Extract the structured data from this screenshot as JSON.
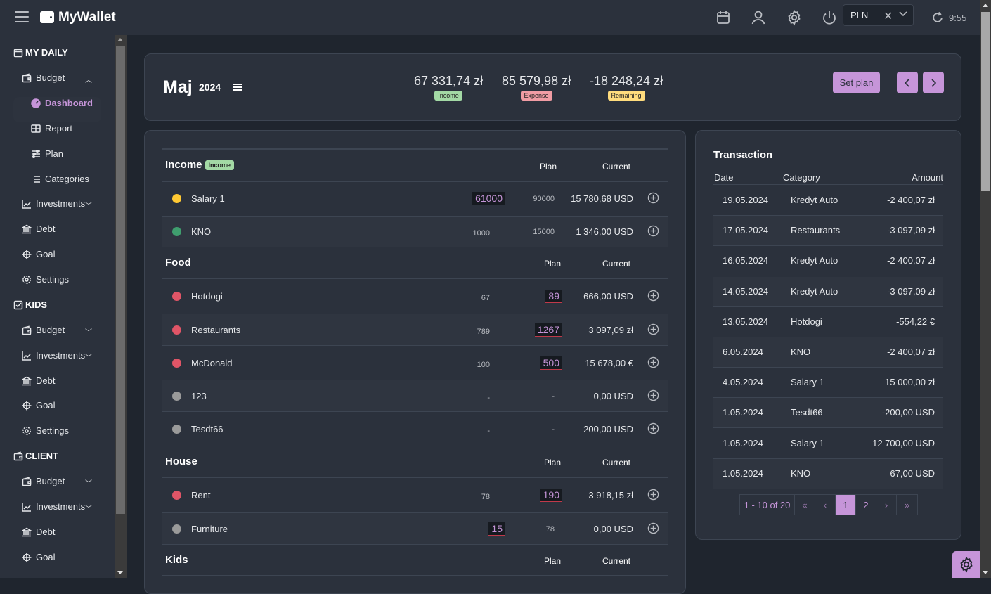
{
  "app": {
    "title": "MyWallet",
    "clock": "9:55"
  },
  "topbar": {
    "currency": "PLN",
    "icons": [
      "calendar-icon",
      "user-icon",
      "gear-icon",
      "power-icon",
      "refresh-icon"
    ]
  },
  "sidebar": {
    "sections": [
      {
        "label": "MY DAILY",
        "items": [
          {
            "label": "Budget",
            "expanded": true,
            "children": [
              "Dashboard",
              "Report",
              "Plan",
              "Categories"
            ]
          },
          {
            "label": "Investments"
          },
          {
            "label": "Debt"
          },
          {
            "label": "Goal"
          },
          {
            "label": "Settings"
          }
        ]
      },
      {
        "label": "KIDS",
        "items": [
          {
            "label": "Budget"
          },
          {
            "label": "Investments"
          },
          {
            "label": "Debt"
          },
          {
            "label": "Goal"
          },
          {
            "label": "Settings"
          }
        ]
      },
      {
        "label": "CLIENT",
        "items": [
          {
            "label": "Budget"
          },
          {
            "label": "Investments"
          },
          {
            "label": "Debt"
          },
          {
            "label": "Goal"
          }
        ]
      }
    ],
    "active": "Dashboard"
  },
  "summary": {
    "month": "Maj",
    "year": "2024",
    "income": {
      "value": "67 331,74 zł",
      "label": "Income",
      "color": "#a3d9a5"
    },
    "expense": {
      "value": "85 579,98 zł",
      "label": "Expense",
      "color": "#f19ca4"
    },
    "remaining": {
      "value": "-18 248,24 zł",
      "label": "Remaining",
      "color": "#ffdc7d"
    },
    "set_plan_label": "Set plan"
  },
  "budget": {
    "plan_header": "Plan",
    "current_header": "Current",
    "income_badge": "Income",
    "sections": [
      {
        "title": "Income",
        "rows": [
          {
            "name": "Salary 1",
            "color": "#ffc933",
            "col1": "61000",
            "col1_input": true,
            "col2": "90000",
            "col2_input": false,
            "current": "15 780,68 USD"
          },
          {
            "name": "KNO",
            "color": "#3f9e6e",
            "col1": "1000",
            "col1_input": false,
            "col2": "15000",
            "col2_input": false,
            "current": "1 346,00 USD"
          }
        ]
      },
      {
        "title": "Food",
        "rows": [
          {
            "name": "Hotdogi",
            "color": "#e05567",
            "col1": "67",
            "col1_input": false,
            "col2": "89",
            "col2_input": true,
            "current": "666,00 USD"
          },
          {
            "name": "Restaurants",
            "color": "#e05567",
            "col1": "789",
            "col1_input": false,
            "col2": "1267",
            "col2_input": true,
            "current": "3 097,09 zł"
          },
          {
            "name": "McDonald",
            "color": "#e05567",
            "col1": "100",
            "col1_input": false,
            "col2": "500",
            "col2_input": true,
            "current": "15 678,00 €"
          },
          {
            "name": "123",
            "color": "#9a9a9a",
            "col1": "-",
            "col1_input": false,
            "col2": "-",
            "col2_input": false,
            "current": "0,00 USD"
          },
          {
            "name": "Tesdt66",
            "color": "#9a9a9a",
            "col1": "-",
            "col1_input": false,
            "col2": "-",
            "col2_input": false,
            "current": "200,00 USD"
          }
        ]
      },
      {
        "title": "House",
        "rows": [
          {
            "name": "Rent",
            "color": "#e05567",
            "col1": "78",
            "col1_input": false,
            "col2": "190",
            "col2_input": true,
            "current": "3 918,15 zł"
          },
          {
            "name": "Furniture",
            "color": "#9a9a9a",
            "col1": "15",
            "col1_input": true,
            "col2": "78",
            "col2_input": false,
            "current": "0,00 USD"
          }
        ]
      },
      {
        "title": "Kids",
        "rows": []
      }
    ]
  },
  "transactions": {
    "title": "Transaction",
    "headers": {
      "date": "Date",
      "category": "Category",
      "amount": "Amount"
    },
    "rows": [
      {
        "date": "19.05.2024",
        "category": "Kredyt Auto",
        "amount": "-2 400,07 zł"
      },
      {
        "date": "17.05.2024",
        "category": "Restaurants",
        "amount": "-3 097,09 zł"
      },
      {
        "date": "16.05.2024",
        "category": "Kredyt Auto",
        "amount": "-2 400,07 zł"
      },
      {
        "date": "14.05.2024",
        "category": "Kredyt Auto",
        "amount": "-3 097,09 zł"
      },
      {
        "date": "13.05.2024",
        "category": "Hotdogi",
        "amount": "-554,22 €"
      },
      {
        "date": "6.05.2024",
        "category": "KNO",
        "amount": "-2 400,07 zł"
      },
      {
        "date": "4.05.2024",
        "category": "Salary 1",
        "amount": "15 000,00 zł"
      },
      {
        "date": "1.05.2024",
        "category": "Tesdt66",
        "amount": "-200,00 USD"
      },
      {
        "date": "1.05.2024",
        "category": "Salary 1",
        "amount": "12 700,00 USD"
      },
      {
        "date": "1.05.2024",
        "category": "KNO",
        "amount": "67,00 USD"
      }
    ],
    "pagination": {
      "info": "1 - 10 of 20",
      "first": "«",
      "prev": "‹",
      "pages": [
        "1",
        "2"
      ],
      "current": "1",
      "next": "›",
      "last": "»"
    }
  },
  "theme": {
    "accent": "#c695d9",
    "bg": "#1f252e",
    "card": "#2b313c"
  }
}
